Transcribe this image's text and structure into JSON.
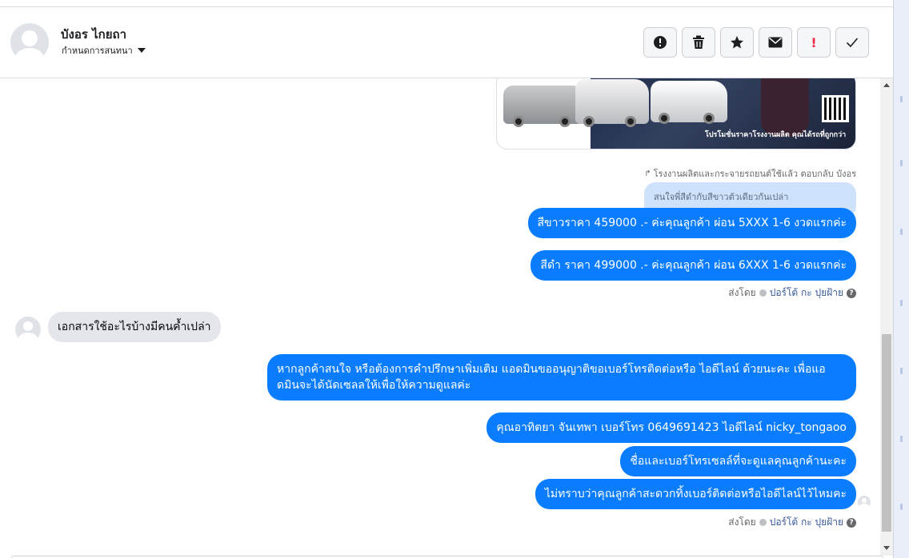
{
  "header": {
    "contact_name": "บังอร ไกยถา",
    "assign_label": "กำหนดการสนทนา",
    "actions": [
      {
        "name": "report-spam",
        "icon": "exclamation-circle-icon"
      },
      {
        "name": "delete",
        "icon": "trash-icon"
      },
      {
        "name": "star",
        "icon": "star-icon"
      },
      {
        "name": "mark-unread",
        "icon": "envelope-icon"
      },
      {
        "name": "follow-up",
        "icon": "red-exclamation-icon",
        "label": "!"
      },
      {
        "name": "mark-done",
        "icon": "checkmark-icon"
      }
    ]
  },
  "conversation": {
    "image_card": {
      "promo_text": "โปรโมชั่นราคาโรงงานผลิต คุณได้รถที่ถูกกว่า"
    },
    "reply_meta": "โรงงานผลิตและกระจายรถยนต์ใช้แล้ว ตอบกลับ บังอร",
    "reply_quote": "สนใจพี่สีดำกับสีขาวตัวเดียวกันเปล่า",
    "out_group_1": [
      "สีขาวราคา 459000 .- ค่ะคุณลูกค้า ผ่อน 5XXX 1-6 งวดแรกค่ะ",
      "สีดำ ราคา 499000 .- ค่ะคุณลูกค้า  ผ่อน 6XXX 1-6 งวดแรกค่ะ"
    ],
    "sent_by_1": {
      "prefix": "ส่งโดย",
      "name": "ปอร์โต้ กะ ปุยฝ้าย"
    },
    "incoming": "เอกสารใช้อะไรบ้างมีคนค้ำเปล่า",
    "out_group_2": [
      "หากลูกค้าสนใจ หรือต้องการคำปรึกษาเพิ่มเติม แอดมินขออนุญาติขอเบอร์โทรติดต่อหรือ ไอดีไลน์ ด้วยนะคะ เพื่อแอดมินจะได้นัดเซลลให้เพื่อให้ความดูแลค่ะ",
      "คุณอาทิตยา จันเทพา     เบอร์โทร 0649691423  ไอดีไลน์ nicky_tongaoo",
      "ชื่อและเบอร์โทรเซลล์ที่จะดูแลคุณลูกค้านะคะ",
      "ไม่ทราบว่าคุณลูกค้าสะดวกทิ้งเบอร์ติดต่อหรือไอดีไลน์ไว้ไหมคะ"
    ],
    "sent_by_2": {
      "prefix": "ส่งโดย",
      "name": "ปอร์โต้ กะ ปุยฝ้าย"
    }
  },
  "colors": {
    "outgoing_bubble": "#0a7cff",
    "incoming_bubble": "#e4e6eb",
    "reply_quote_bg": "#cfe2fb"
  }
}
